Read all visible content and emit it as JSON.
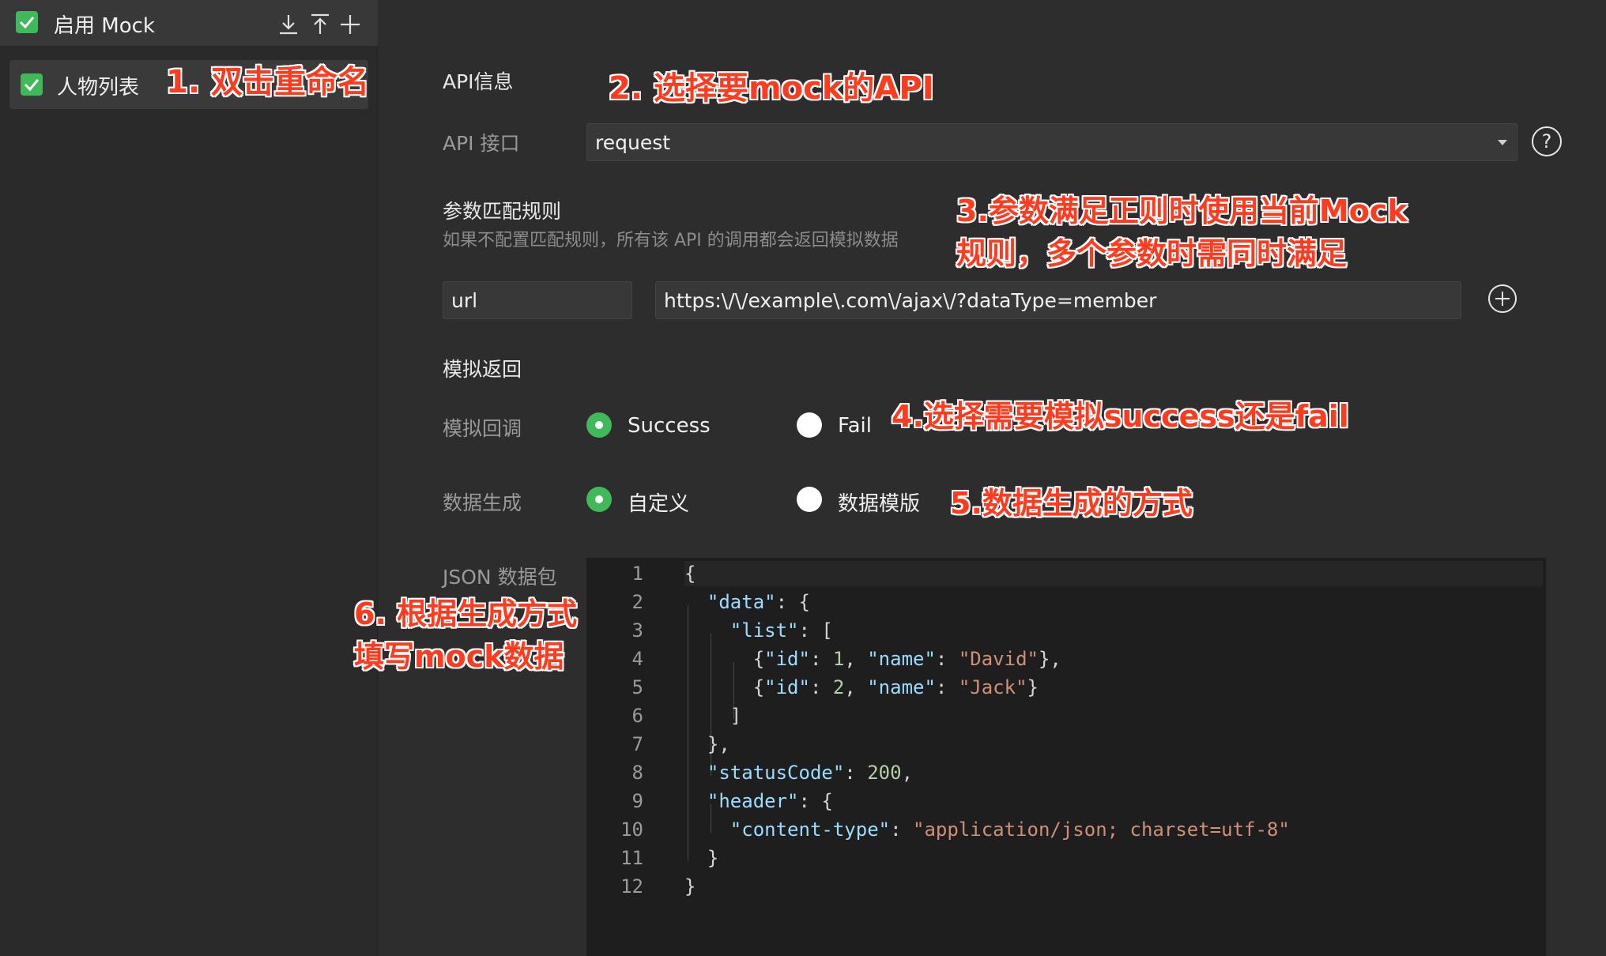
{
  "sidebar": {
    "title": "启用 Mock",
    "toolbar": {
      "download_icon": "download-icon",
      "upload_icon": "upload-icon",
      "add_icon": "plus-icon"
    },
    "items": [
      {
        "label": "人物列表",
        "checked": true
      }
    ]
  },
  "api_section": {
    "heading": "API信息",
    "api_label": "API 接口",
    "api_value": "request"
  },
  "params_section": {
    "heading": "参数匹配规则",
    "hint": "如果不配置匹配规则，所有该 API 的调用都会返回模拟数据",
    "param_key": "url",
    "param_value": "https:\\/\\/example\\.com\\/ajax\\/?dataType=member"
  },
  "mock_section": {
    "heading": "模拟返回",
    "callback_label": "模拟回调",
    "callback_options": [
      "Success",
      "Fail"
    ],
    "callback_selected": "Success",
    "gen_label": "数据生成",
    "gen_options": [
      "自定义",
      "数据模版"
    ],
    "gen_selected": "自定义",
    "json_label": "JSON 数据包"
  },
  "editor": {
    "line_numbers": [
      "1",
      "2",
      "3",
      "4",
      "5",
      "6",
      "7",
      "8",
      "9",
      "10",
      "11",
      "12"
    ],
    "lines": [
      "{",
      "  \"data\": {",
      "    \"list\": [",
      "      {\"id\": 1, \"name\": \"David\"},",
      "      {\"id\": 2, \"name\": \"Jack\"}",
      "    ]",
      "  },",
      "  \"statusCode\": 200,",
      "  \"header\": {",
      "    \"content-type\": \"application/json; charset=utf-8\"",
      "  }",
      "}"
    ]
  },
  "annotations": {
    "a1": "1. 双击重命名",
    "a2": "2. 选择要mock的API",
    "a3_line1": "3.参数满足正则时使用当前Mock",
    "a3_line2": "规则，多个参数时需同时满足",
    "a4": "4.选择需要模拟success还是fail",
    "a5": "5.数据生成的方式",
    "a6_line1": "6. 根据生成方式",
    "a6_line2": "填写mock数据"
  },
  "colors": {
    "accent_green": "#3fb95a",
    "annotation_red": "#ff3b1f",
    "background": "#2d2d2d"
  }
}
